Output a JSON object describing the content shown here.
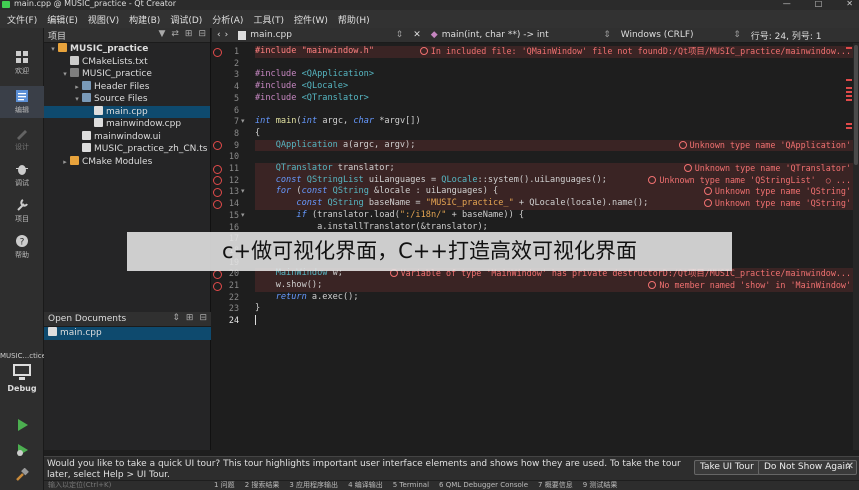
{
  "window": {
    "title": "main.cpp @ MUSIC_practice - Qt Creator",
    "controls": [
      "—",
      "□",
      "✕"
    ]
  },
  "menu": [
    "文件(F)",
    "编辑(E)",
    "视图(V)",
    "构建(B)",
    "调试(D)",
    "分析(A)",
    "工具(T)",
    "控件(W)",
    "帮助(H)"
  ],
  "modes": [
    {
      "label": "欢迎",
      "icon": "welcome-icon"
    },
    {
      "label": "编辑",
      "icon": "edit-icon"
    },
    {
      "label": "设计",
      "icon": "design-icon"
    },
    {
      "label": "调试",
      "icon": "debug-icon"
    },
    {
      "label": "项目",
      "icon": "projects-icon"
    },
    {
      "label": "帮助",
      "icon": "help-icon"
    }
  ],
  "kit": {
    "project": "MUSIC...ctice",
    "config": "Debug"
  },
  "projects_panel": {
    "title": "项目",
    "tree": [
      {
        "label": "MUSIC_practice",
        "depth": 0,
        "arrow": "▾",
        "bold": true,
        "icon_color": "#e8a33c"
      },
      {
        "label": "CMakeLists.txt",
        "depth": 1,
        "arrow": "",
        "icon_color": "#cccccc"
      },
      {
        "label": "MUSIC_practice",
        "depth": 1,
        "arrow": "▾",
        "icon_color": "#7e7e7e"
      },
      {
        "label": "Header Files",
        "depth": 2,
        "arrow": "▸",
        "icon_color": "#7a9ab8"
      },
      {
        "label": "Source Files",
        "depth": 2,
        "arrow": "▾",
        "icon_color": "#7a9ab8"
      },
      {
        "label": "main.cpp",
        "depth": 3,
        "arrow": "",
        "icon_color": "#dddddd",
        "selected": true
      },
      {
        "label": "mainwindow.cpp",
        "depth": 3,
        "arrow": "",
        "icon_color": "#dddddd"
      },
      {
        "label": "mainwindow.ui",
        "depth": 2,
        "arrow": "",
        "icon_color": "#dddddd"
      },
      {
        "label": "MUSIC_practice_zh_CN.ts",
        "depth": 2,
        "arrow": "",
        "icon_color": "#dddddd"
      },
      {
        "label": "CMake Modules",
        "depth": 1,
        "arrow": "▸",
        "icon_color": "#e8a33c"
      }
    ]
  },
  "open_documents": {
    "title": "Open Documents",
    "items": [
      "main.cpp"
    ]
  },
  "editor_toolbar": {
    "file": "main.cpp",
    "symbol": "main(int, char **) -> int",
    "line_endings": "Windows (CRLF)",
    "position": "行号: 24, 列号: 1"
  },
  "code_lines": [
    {
      "n": "1",
      "html": "<span class='inc'>#include \"mainwindow.h\"</span>",
      "err": true
    },
    {
      "n": "2",
      "html": ""
    },
    {
      "n": "3",
      "html": "<span class='k'>#include</span> <span class='t'>&lt;QApplication&gt;</span>"
    },
    {
      "n": "4",
      "html": "<span class='k'>#include</span> <span class='t'>&lt;QLocale&gt;</span>"
    },
    {
      "n": "5",
      "html": "<span class='k'>#include</span> <span class='t'>&lt;QTranslator&gt;</span>"
    },
    {
      "n": "6",
      "html": ""
    },
    {
      "n": "7",
      "html": "<span class='kw'>int</span> <span class='f'>main</span>(<span class='kw'>int</span> argc, <span class='kw'>char</span> *<span class='pl'>argv</span>[])",
      "fold": true
    },
    {
      "n": "8",
      "html": "{"
    },
    {
      "n": "9",
      "html": "    <span class='t'>QApplication</span> a(argc, argv);",
      "err": true
    },
    {
      "n": "10",
      "html": ""
    },
    {
      "n": "11",
      "html": "    <span class='t'>QTranslator</span> translator;",
      "err": true
    },
    {
      "n": "12",
      "html": "    <span class='kw'>const</span> <span class='t'>QStringList</span> uiLanguages = <span class='t'>QLocale</span>::system().uiLanguages();",
      "err": true
    },
    {
      "n": "13",
      "html": "    <span class='kw'>for</span> (<span class='kw'>const</span> <span class='t'>QString</span> &amp;locale : uiLanguages) {",
      "err": true,
      "fold": true
    },
    {
      "n": "14",
      "html": "        <span class='kw'>const</span> <span class='t'>QString</span> baseName = <span class='s'>\"MUSIC_practice_\"</span> + QLocale(locale).name();",
      "err": true
    },
    {
      "n": "15",
      "html": "        <span class='kw'>if</span> (translator.load(<span class='s'>\":/i18n/\"</span> + baseName)) {",
      "fold": true
    },
    {
      "n": "16",
      "html": "            a.installTranslator(&amp;translator);"
    },
    {
      "n": "17",
      "html": ""
    },
    {
      "n": "18",
      "html": ""
    },
    {
      "n": "19",
      "html": ""
    },
    {
      "n": "20",
      "html": "    <span class='t'>MainWindow</span> w;",
      "err": true
    },
    {
      "n": "21",
      "html": "    w.show();",
      "err": true
    },
    {
      "n": "22",
      "html": "    <span class='kw'>return</span> a.exec();"
    },
    {
      "n": "23",
      "html": "}"
    },
    {
      "n": "24",
      "html": "",
      "current": true
    }
  ],
  "diagnostics": [
    {
      "line": 0,
      "text": "In included file: 'QMainWindow' file not foundD:/Qt项目/MUSIC_practice/mainwindow..."
    },
    {
      "line": 8,
      "text": "Unknown type name 'QApplication'"
    },
    {
      "line": 10,
      "text": "Unknown type name 'QTranslator'"
    },
    {
      "line": 11,
      "text": "Unknown type name 'QStringList'  ○ ..."
    },
    {
      "line": 12,
      "text": "Unknown type name 'QString'"
    },
    {
      "line": 13,
      "text": "Unknown type name 'QString'"
    },
    {
      "line": 19,
      "text": "Variable of type 'MainWindow' has private destructorD:/Qt项目/MUSIC_practice/mainwindow..."
    },
    {
      "line": 20,
      "text": "No member named 'show' in 'MainWindow'"
    }
  ],
  "overlay_banner": "c+做可视化界面，C++打造高效可视化界面",
  "tour": {
    "message": "Would you like to take a quick UI tour? This tour highlights important user interface elements and shows how they are used. To take the tour later, select Help > UI Tour.",
    "take_button": "Take UI Tour",
    "dismiss_button": "Do Not Show Again",
    "close": "✕"
  },
  "status_tabs": [
    "1 问题",
    "2 搜索结果",
    "3 应用程序输出",
    "4 编译输出",
    "5 Terminal",
    "6 QML Debugger Console",
    "7 概要信息",
    "9 测试结果"
  ],
  "locator_placeholder": "输入以定位(Ctrl+K)"
}
